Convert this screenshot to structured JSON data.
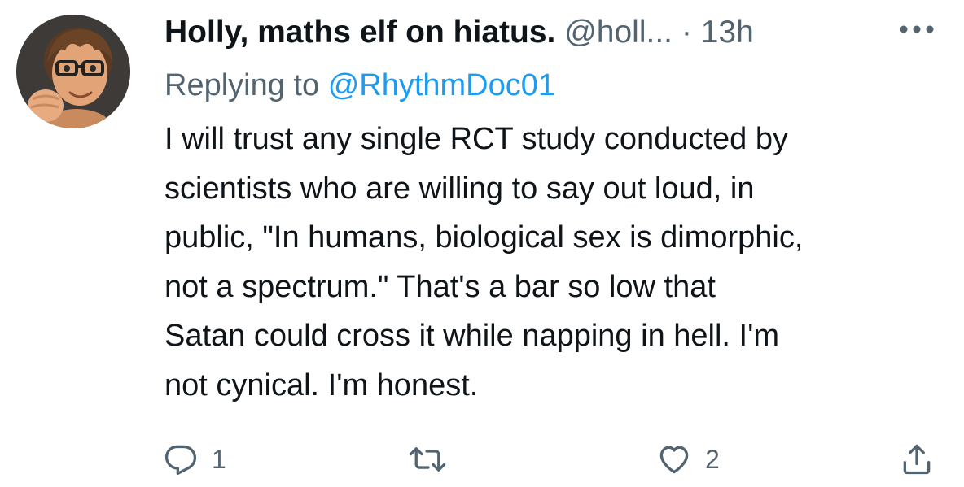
{
  "tweet": {
    "display_name": "Holly, maths elf on hiatus.",
    "handle": "@holl...",
    "separator": "·",
    "time": "13h",
    "replying_label": "Replying to",
    "replying_to": "@RhythmDoc01",
    "text_lines": [
      "I will trust any single RCT study conducted by",
      "scientists who are willing to say out loud, in",
      "public, \"In humans, biological sex is dimorphic,",
      "not a spectrum.\" That's a bar so low that",
      "Satan could cross it while napping in hell. I'm",
      "not cynical. I'm honest."
    ]
  },
  "actions": {
    "reply_count": "1",
    "retweet_count": "",
    "like_count": "2"
  },
  "colors": {
    "text_primary": "#0f1419",
    "text_secondary": "#536471",
    "link": "#1d9bf0"
  },
  "icons": [
    "avatar-memoji",
    "more-icon",
    "reply-icon",
    "retweet-icon",
    "like-icon",
    "share-icon"
  ]
}
